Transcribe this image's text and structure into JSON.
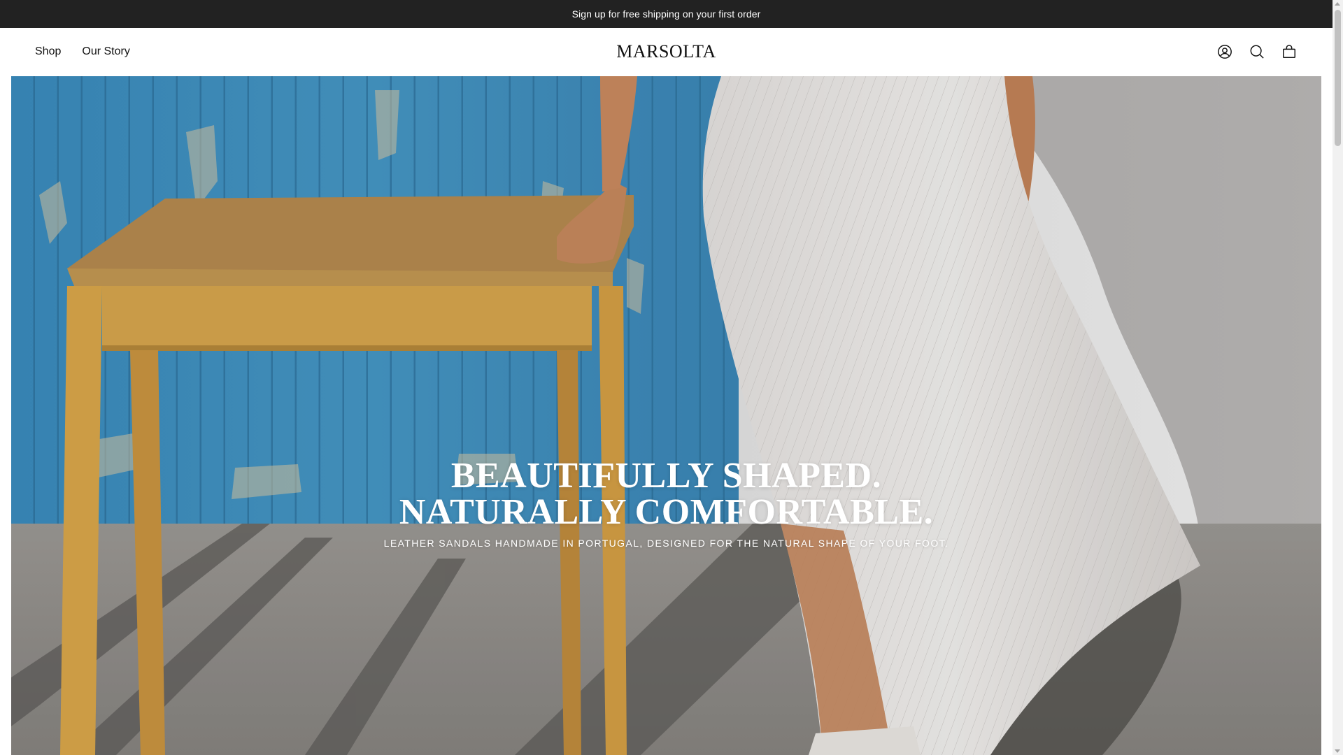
{
  "announcement": {
    "text": "Sign up for free shipping on your first order"
  },
  "header": {
    "nav": [
      {
        "label": "Shop"
      },
      {
        "label": "Our Story"
      }
    ],
    "logo": "MARSOLTA",
    "icons": [
      "account-icon",
      "search-icon",
      "cart-icon"
    ]
  },
  "hero": {
    "title": "BEAUTIFULLY SHAPED. NATURALLY COMFORTABLE.",
    "subtitle": "LEATHER SANDALS HANDMADE IN PORTUGAL, DESIGNED FOR THE NATURAL SHAPE OF YOUR FOOT.",
    "image_description_colors": {
      "wall": "#3f8fbf",
      "ground": "#8f8c88",
      "table": "#c79a4c",
      "dress": "#e9e6e4"
    }
  },
  "colors": {
    "announcement_bg": "#222222",
    "text": "#111111"
  }
}
